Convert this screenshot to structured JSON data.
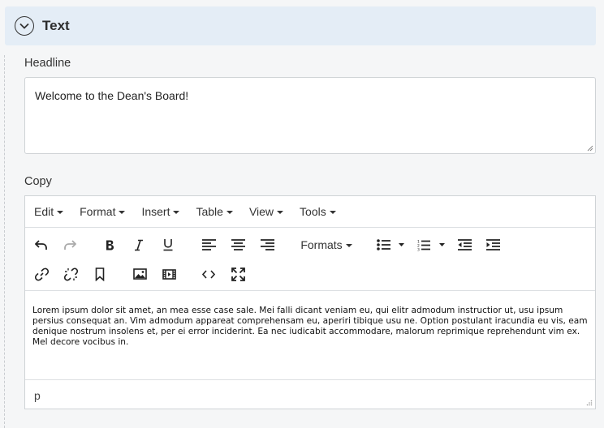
{
  "section": {
    "title": "Text",
    "toggle_icon": "chevron-down-icon"
  },
  "headline": {
    "label": "Headline",
    "value": "Welcome to the Dean's Board!"
  },
  "copy": {
    "label": "Copy",
    "menu": [
      {
        "label": "Edit"
      },
      {
        "label": "Format"
      },
      {
        "label": "Insert"
      },
      {
        "label": "Table"
      },
      {
        "label": "View"
      },
      {
        "label": "Tools"
      }
    ],
    "toolbar": {
      "formats_label": "Formats",
      "icons": [
        "undo-icon",
        "redo-icon",
        "bold-icon",
        "italic-icon",
        "underline-icon",
        "align-left-icon",
        "align-center-icon",
        "align-right-icon",
        "bullet-list-icon",
        "numbered-list-icon",
        "outdent-icon",
        "indent-icon",
        "link-icon",
        "unlink-icon",
        "bookmark-icon",
        "image-icon",
        "media-icon",
        "code-icon",
        "fullscreen-icon"
      ]
    },
    "content": "Lorem ipsum dolor sit amet, an mea esse case sale. Mei falli dicant veniam eu, qui elitr admodum instructior ut, usu ipsum persius consequat an. Vim admodum appareat comprehensam eu, aperiri tibique usu ne. Option postulant iracundia eu vis, eam denique nostrum insolens et, per ei error inciderint. Ea nec iudicabit accommodare, malorum reprimique reprehendunt vim ex. Mel decore vocibus in.",
    "status_path": "p"
  },
  "colors": {
    "header_bg": "#e4edf6",
    "page_bg": "#f5f6f7",
    "border": "#cfd3d6"
  }
}
